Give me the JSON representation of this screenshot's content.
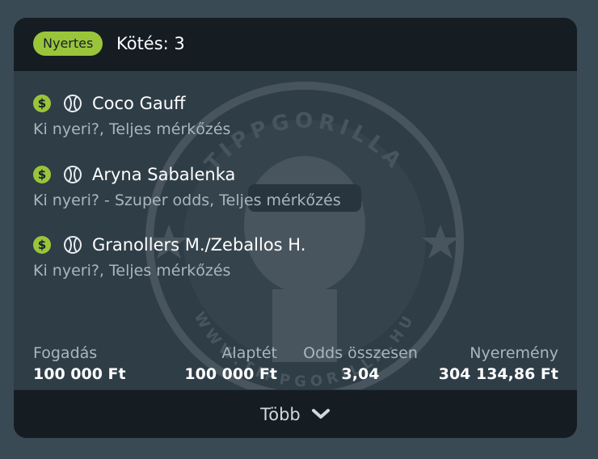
{
  "header": {
    "badge": "Nyertes",
    "title": "Kötés: 3"
  },
  "watermark": {
    "text_top": "TIPPGORILLA",
    "text_bottom": "WWW.TIPPGORILLA.HU"
  },
  "selections": [
    {
      "name": "Coco Gauff",
      "market": "Ki nyeri?, Teljes mérkőzés",
      "currency_icon": "dollar-icon",
      "sport_icon": "tennis-ball-icon"
    },
    {
      "name": "Aryna Sabalenka",
      "market": "Ki nyeri? - Szuper odds, Teljes mérkőzés",
      "currency_icon": "dollar-icon",
      "sport_icon": "tennis-ball-icon"
    },
    {
      "name": "Granollers M./Zeballos H.",
      "market": "Ki nyeri?, Teljes mérkőzés",
      "currency_icon": "dollar-icon",
      "sport_icon": "tennis-ball-icon"
    }
  ],
  "summary": {
    "stake_label": "Fogadás",
    "stake_value": "100 000 Ft",
    "base_label": "Alaptét",
    "base_value": "100 000 Ft",
    "odds_label": "Odds összesen",
    "odds_value": "3,04",
    "win_label": "Nyeremény",
    "win_value": "304 134,86 Ft"
  },
  "footer": {
    "more_label": "Több"
  },
  "colors": {
    "accent": "#9ac53b",
    "page_bg": "#3a4a55",
    "card_bg": "#2f3d47",
    "header_bg": "#151c22",
    "muted_text": "#a9b6bf"
  }
}
